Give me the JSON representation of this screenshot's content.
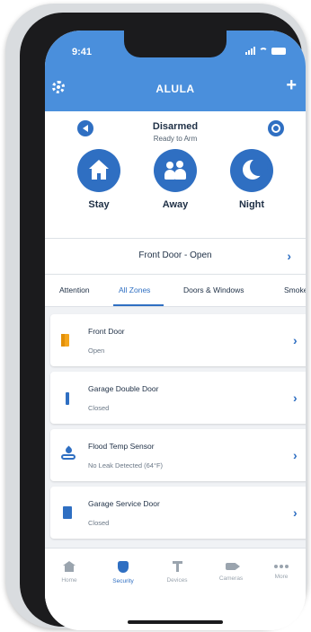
{
  "status_bar": {
    "time": "9:41"
  },
  "header": {
    "title": "ALULA",
    "add_label": "+"
  },
  "arm": {
    "status": "Disarmed",
    "substatus": "Ready to Arm"
  },
  "modes": [
    {
      "label": "Stay",
      "icon": "house-icon"
    },
    {
      "label": "Away",
      "icon": "people-icon"
    },
    {
      "label": "Night",
      "icon": "moon-icon"
    }
  ],
  "alert": {
    "text": "Front Door - Open"
  },
  "tabs": [
    {
      "label": "Attention"
    },
    {
      "label": "All Zones",
      "active": true
    },
    {
      "label": "Doors & Windows"
    },
    {
      "label": "Smoke"
    }
  ],
  "zones": [
    {
      "name": "Front Door",
      "status": "Open",
      "icon": "door-open-icon"
    },
    {
      "name": "Garage Double Door",
      "status": "Closed",
      "icon": "door-closed-icon"
    },
    {
      "name": "Flood Temp Sensor",
      "status": "No Leak Detected (64°F)",
      "icon": "flood-sensor-icon"
    },
    {
      "name": "Garage Service Door",
      "status": "Closed",
      "icon": "door-closed-icon"
    }
  ],
  "nav": [
    {
      "label": "Home"
    },
    {
      "label": "Security",
      "active": true
    },
    {
      "label": "Devices"
    },
    {
      "label": "Cameras"
    },
    {
      "label": "More"
    }
  ],
  "colors": {
    "brand_header": "#4a8fdc",
    "accent": "#2f6fc2",
    "open_warning": "#f4a51c"
  }
}
